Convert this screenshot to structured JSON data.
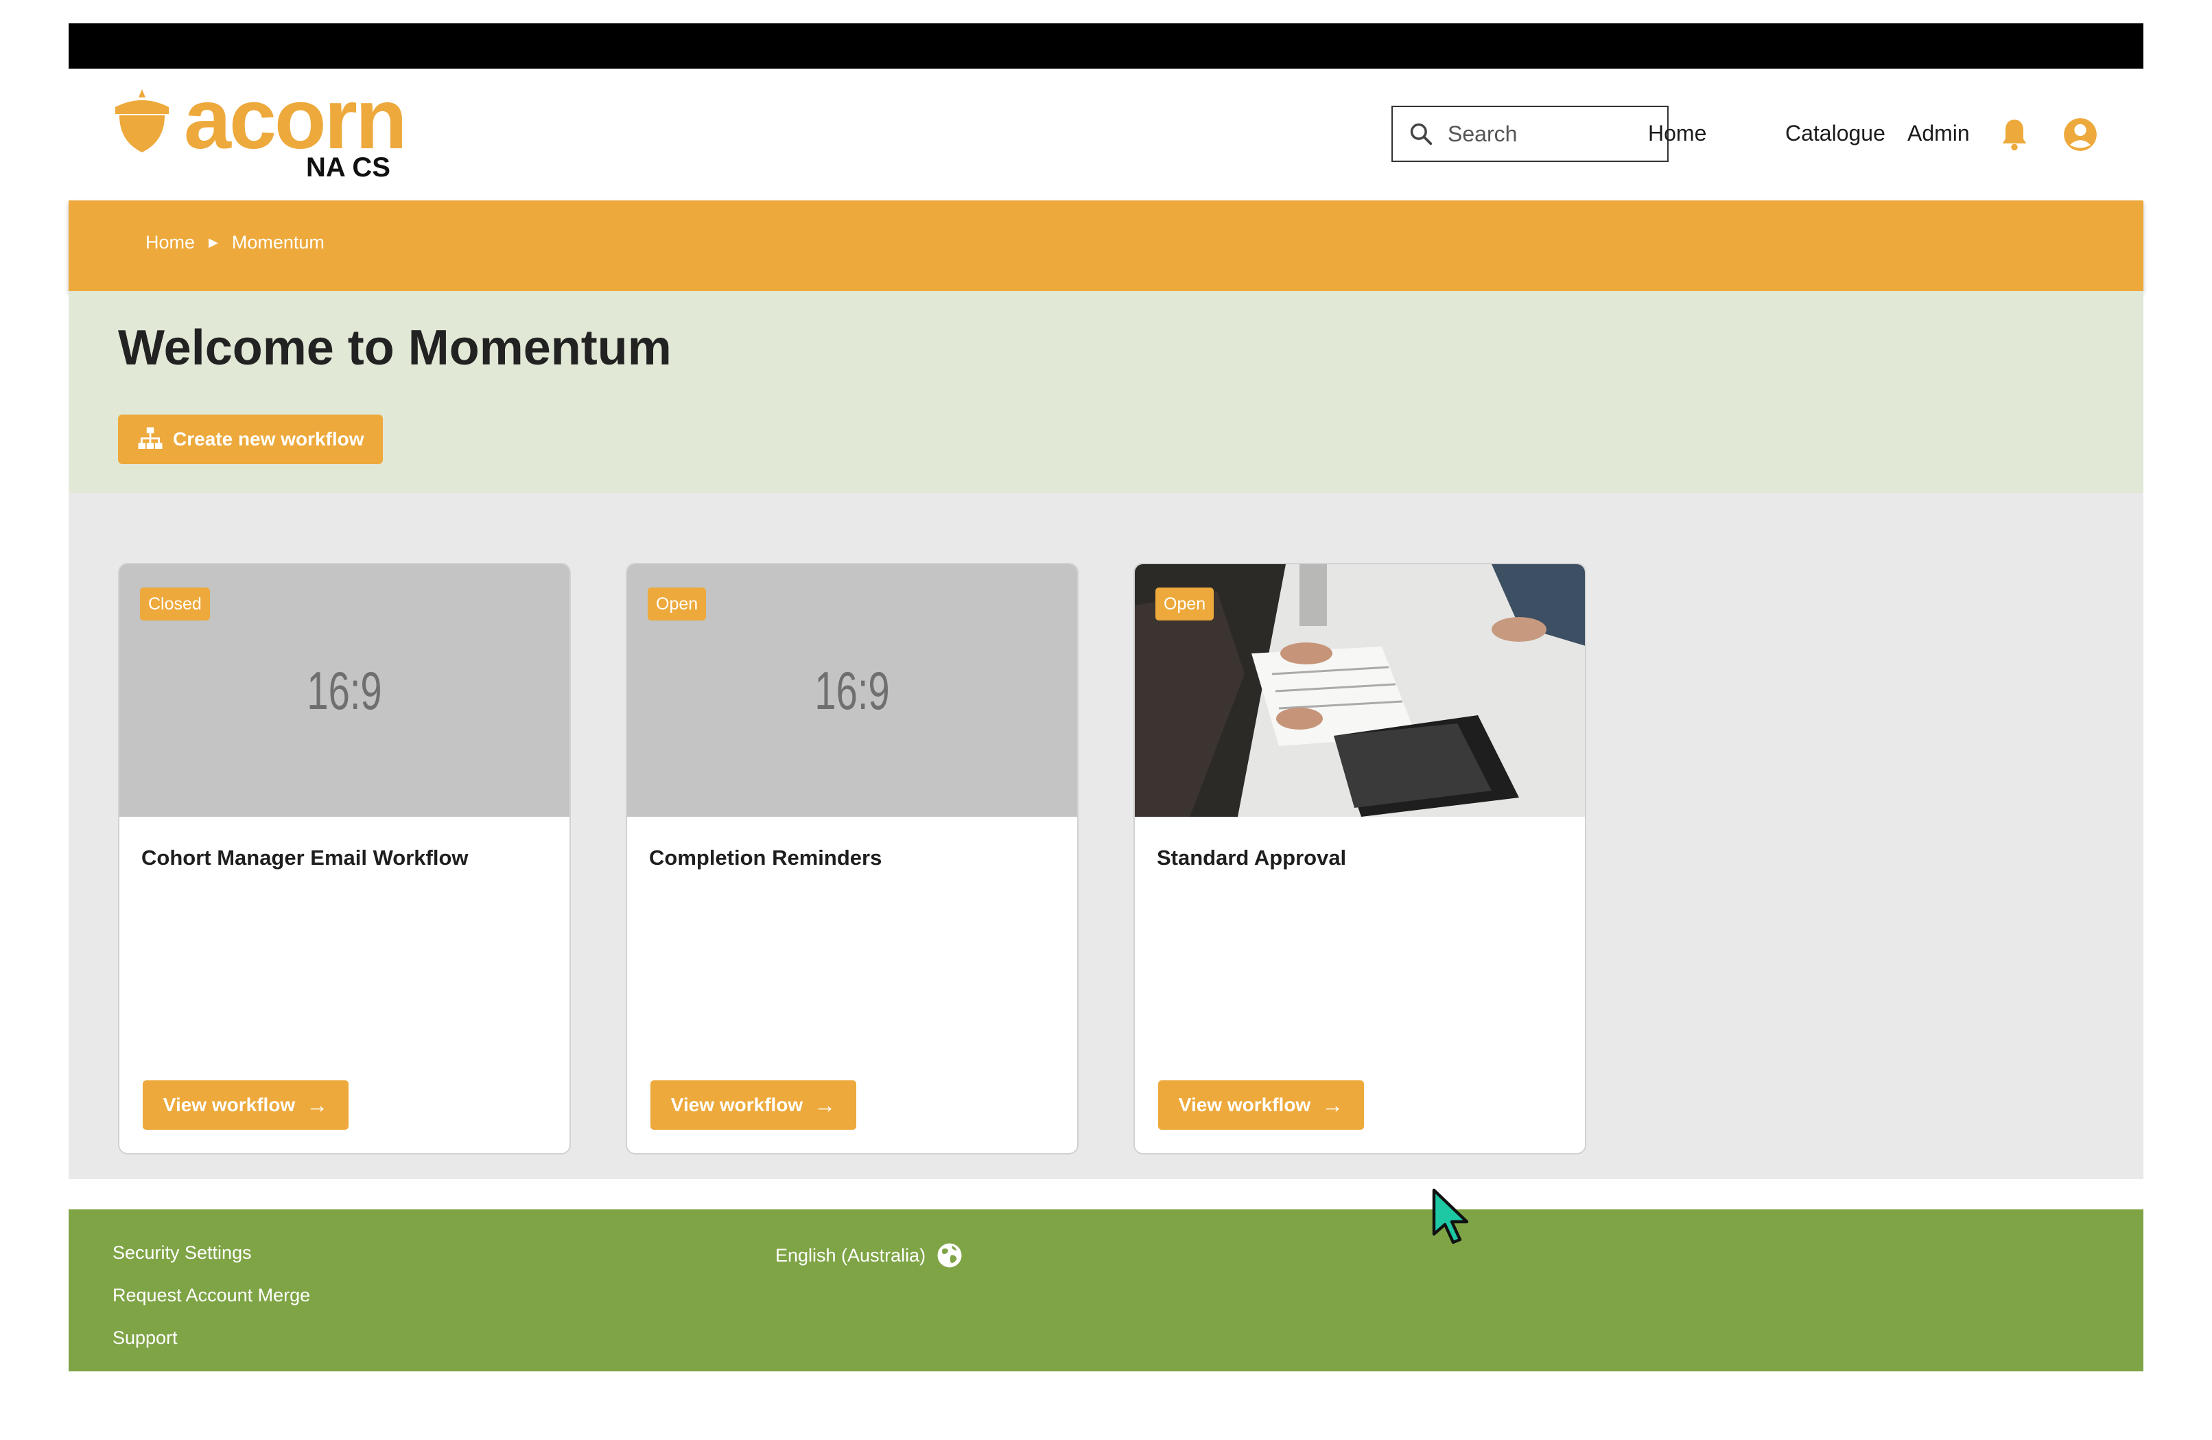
{
  "brand": {
    "name": "acorn",
    "subtitle": "NA CS",
    "accent_color": "#eda93b",
    "logo_icon": "acorn-icon"
  },
  "header": {
    "search": {
      "placeholder": "Search",
      "icon": "search-icon"
    },
    "nav": [
      "Home",
      "Catalogue",
      "Admin"
    ],
    "icons": [
      "bell-icon",
      "user-circle-icon"
    ]
  },
  "breadcrumb": {
    "items": [
      "Home",
      "Momentum"
    ],
    "separator_icon": "caret-right-icon"
  },
  "hero": {
    "title": "Welcome to Momentum",
    "create_button": "Create new workflow",
    "create_icon": "sitemap-icon",
    "background": "#e1e8d6"
  },
  "cards": [
    {
      "status": "Closed",
      "title": "Cohort Manager Email Workflow",
      "media_placeholder": "16:9",
      "button": "View workflow"
    },
    {
      "status": "Open",
      "title": "Completion Reminders",
      "media_placeholder": "16:9",
      "button": "View workflow"
    },
    {
      "status": "Open",
      "title": "Standard Approval",
      "media_placeholder": "",
      "media_type": "photo",
      "button": "View workflow"
    }
  ],
  "footer": {
    "links": [
      "Security Settings",
      "Request Account Merge",
      "Support"
    ],
    "language": "English (Australia)",
    "language_icon": "globe-icon",
    "background": "#7fa446"
  }
}
